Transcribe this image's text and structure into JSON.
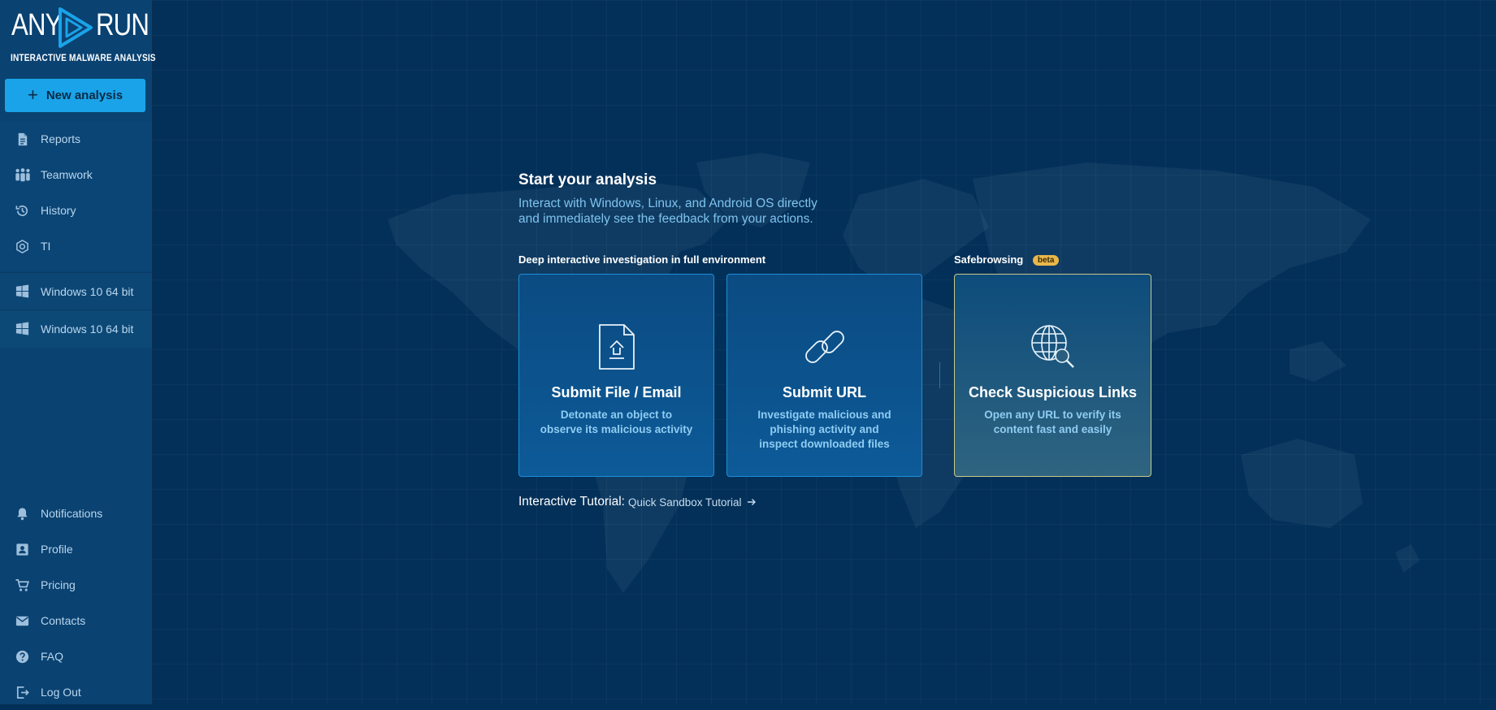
{
  "logo": {
    "word_left": "ANY",
    "word_right": "RUN",
    "tagline": "INTERACTIVE MALWARE ANALYSIS"
  },
  "sidebar": {
    "new_analysis": "New analysis",
    "items": [
      {
        "label": "Reports",
        "icon": "document-icon"
      },
      {
        "label": "Teamwork",
        "icon": "team-icon"
      },
      {
        "label": "History",
        "icon": "history-icon"
      },
      {
        "label": "TI",
        "icon": "ti-icon"
      }
    ],
    "os_tasks": [
      {
        "label": "Windows 10 64 bit",
        "icon": "windows-icon"
      },
      {
        "label": "Windows 10 64 bit",
        "icon": "windows-icon"
      }
    ],
    "bottom_items": [
      {
        "label": "Notifications",
        "icon": "bell-icon"
      },
      {
        "label": "Profile",
        "icon": "profile-icon"
      },
      {
        "label": "Pricing",
        "icon": "cart-icon"
      },
      {
        "label": "Contacts",
        "icon": "mail-icon"
      },
      {
        "label": "FAQ",
        "icon": "help-icon"
      },
      {
        "label": "Log Out",
        "icon": "logout-icon"
      }
    ]
  },
  "main": {
    "title": "Start your analysis",
    "subtitle_line1": "Interact with Windows, Linux, and Android OS directly",
    "subtitle_line2": "and immediately see the feedback from your actions.",
    "deep_label": "Deep interactive investigation in full environment",
    "safe_label": "Safebrowsing",
    "beta": "beta",
    "cards": [
      {
        "title": "Submit File / Email",
        "desc_line1": "Detonate an object to",
        "desc_line2": "observe its malicious activity",
        "desc_line3": "",
        "icon": "file-upload-icon"
      },
      {
        "title": "Submit URL",
        "desc_line1": "Investigate malicious and",
        "desc_line2": "phishing activity and",
        "desc_line3": "inspect downloaded files",
        "icon": "link-icon"
      },
      {
        "title": "Check Suspicious Links",
        "desc_line1": "Open any URL to verify its",
        "desc_line2": "content fast and easily",
        "desc_line3": "",
        "icon": "globe-search-icon"
      }
    ],
    "tutorial_prefix": "Interactive Tutorial:",
    "tutorial_link": "Quick Sandbox Tutorial"
  },
  "colors": {
    "background": "#033058",
    "sidebar": "#0a4271",
    "accent": "#1aa3e8",
    "subtitle": "#7ec3ee",
    "beta": "#e8b74a"
  }
}
